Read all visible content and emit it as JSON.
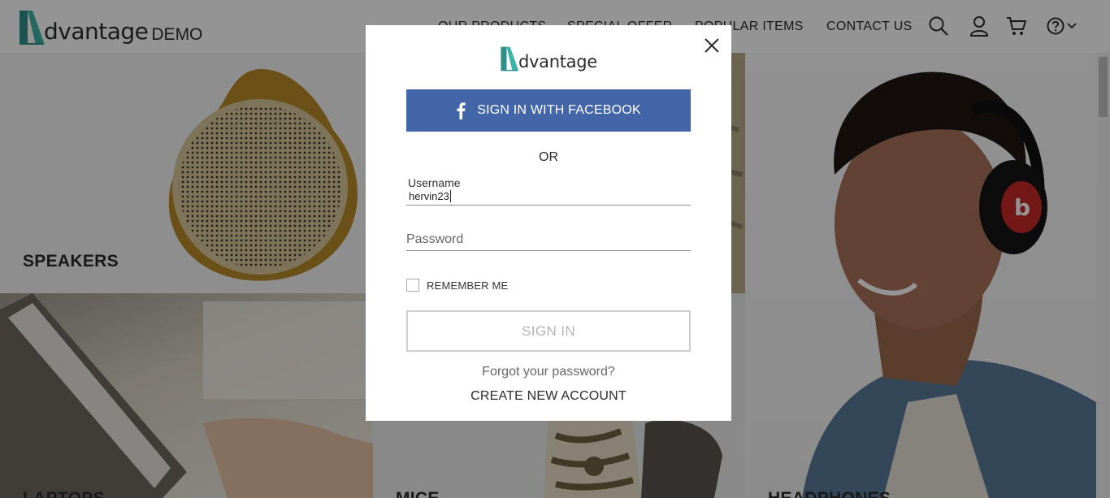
{
  "header": {
    "logo_text": "dvantage",
    "logo_suffix": "DEMO",
    "nav": {
      "products": "OUR PRODUCTS",
      "special_offer": "SPECIAL OFFER",
      "popular_items": "POPULAR ITEMS",
      "contact_us": "CONTACT US"
    },
    "icons": [
      "search-icon",
      "user-icon",
      "cart-icon",
      "help-icon",
      "chevron-down-icon"
    ]
  },
  "categories": {
    "speakers": "SPEAKERS",
    "laptops": "LAPTOPS",
    "mice": "MICE",
    "headphones": "HEADPHONES"
  },
  "modal": {
    "logo_text": "dvantage",
    "facebook_label": "SIGN IN WITH FACEBOOK",
    "or_text": "OR",
    "username_label": "Username",
    "username_value": "hervin23",
    "password_placeholder": "Password",
    "remember_label": "REMEMBER ME",
    "remember_checked": false,
    "signin_label": "SIGN IN",
    "forgot_label": "Forgot your password?",
    "create_label": "CREATE NEW ACCOUNT"
  },
  "colors": {
    "brand_teal": "#33a79a",
    "facebook_blue": "#4266a8",
    "text_dark": "#2b2b2b"
  }
}
